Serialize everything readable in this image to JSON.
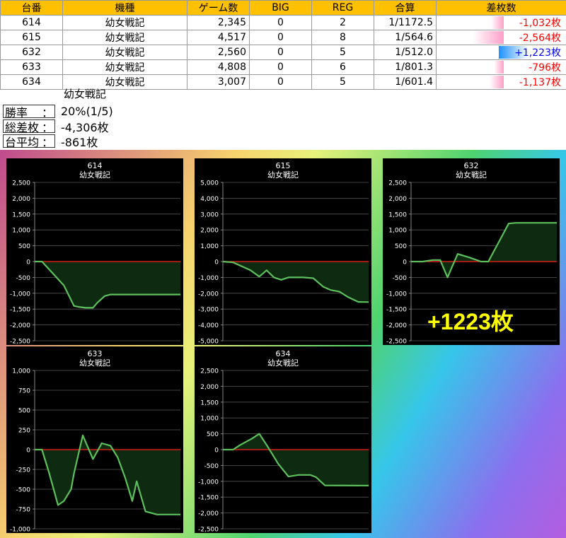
{
  "table": {
    "headers": [
      "台番",
      "機種",
      "ゲーム数",
      "BIG",
      "REG",
      "合算",
      "差枚数"
    ],
    "rows": [
      {
        "no": "614",
        "model": "幼女戦記",
        "games": "2,345",
        "big": "0",
        "reg": "2",
        "combined": "1/1172.5",
        "diff": "-1,032枚",
        "diff_value": -1032
      },
      {
        "no": "615",
        "model": "幼女戦記",
        "games": "4,517",
        "big": "0",
        "reg": "8",
        "combined": "1/564.6",
        "diff": "-2,564枚",
        "diff_value": -2564
      },
      {
        "no": "632",
        "model": "幼女戦記",
        "games": "2,560",
        "big": "0",
        "reg": "5",
        "combined": "1/512.0",
        "diff": "+1,223枚",
        "diff_value": 1223
      },
      {
        "no": "633",
        "model": "幼女戦記",
        "games": "4,808",
        "big": "0",
        "reg": "6",
        "combined": "1/801.3",
        "diff": "-796枚",
        "diff_value": -796
      },
      {
        "no": "634",
        "model": "幼女戦記",
        "games": "3,007",
        "big": "0",
        "reg": "5",
        "combined": "1/601.4",
        "diff": "-1,137枚",
        "diff_value": -1137
      }
    ],
    "colors": {
      "header_bg": "#ffc000",
      "negative": "#ff0000",
      "positive": "#0000ff",
      "neg_bar": "#ff9ec8",
      "pos_bar": "#1e90ff"
    }
  },
  "summary": {
    "title": "幼女戦記",
    "rows": [
      {
        "label": "勝率",
        "colon": "：",
        "value": "20%(1/5)"
      },
      {
        "label": "総差枚",
        "colon": "：",
        "value": "-4,306枚"
      },
      {
        "label": "台平均",
        "colon": "：",
        "value": "-861枚"
      }
    ]
  },
  "highlight_label": "+1223枚",
  "chart_data": [
    {
      "type": "line",
      "title": "614",
      "subtitle": "幼女戦記",
      "ylim": [
        -2500,
        2500
      ],
      "yticks": [
        -2500,
        -2000,
        -1500,
        -1000,
        -500,
        0,
        500,
        1000,
        1500,
        2000,
        2500
      ],
      "grid": true,
      "x": [
        0,
        0.05,
        0.1,
        0.2,
        0.27,
        0.3,
        0.35,
        0.4,
        0.43,
        0.48,
        0.52,
        0.6,
        0.7,
        1.0
      ],
      "y": [
        0,
        0,
        -250,
        -750,
        -1400,
        -1430,
        -1460,
        -1460,
        -1300,
        -1090,
        -1040,
        -1040,
        -1040,
        -1040
      ]
    },
    {
      "type": "line",
      "title": "615",
      "subtitle": "幼女戦記",
      "ylim": [
        -5000,
        5000
      ],
      "yticks": [
        -5000,
        -4000,
        -3000,
        -2000,
        -1000,
        0,
        1000,
        2000,
        3000,
        4000,
        5000
      ],
      "grid": true,
      "x": [
        0,
        0.07,
        0.13,
        0.19,
        0.25,
        0.3,
        0.35,
        0.4,
        0.45,
        0.5,
        0.55,
        0.62,
        0.69,
        0.74,
        0.8,
        0.86,
        0.93,
        1.0
      ],
      "y": [
        0,
        -50,
        -300,
        -550,
        -950,
        -550,
        -1000,
        -1150,
        -1000,
        -1000,
        -1000,
        -1050,
        -1600,
        -1800,
        -1900,
        -2250,
        -2550,
        -2560
      ]
    },
    {
      "type": "line",
      "title": "632",
      "subtitle": "幼女戦記",
      "ylim": [
        -2500,
        2500
      ],
      "yticks": [
        -2500,
        -2000,
        -1500,
        -1000,
        -500,
        0,
        500,
        1000,
        1500,
        2000,
        2500
      ],
      "grid": true,
      "x": [
        0,
        0.08,
        0.15,
        0.2,
        0.25,
        0.32,
        0.4,
        0.48,
        0.53,
        0.6,
        0.67,
        0.72,
        1.0
      ],
      "y": [
        0,
        0,
        50,
        50,
        -500,
        240,
        130,
        0,
        0,
        600,
        1200,
        1223,
        1223
      ]
    },
    {
      "type": "line",
      "title": "633",
      "subtitle": "幼女戦記",
      "ylim": [
        -1000,
        1000
      ],
      "yticks": [
        -1000,
        -750,
        -500,
        -250,
        0,
        250,
        500,
        750,
        1000
      ],
      "grid": true,
      "x": [
        0,
        0.05,
        0.1,
        0.16,
        0.2,
        0.25,
        0.27,
        0.33,
        0.4,
        0.46,
        0.52,
        0.57,
        0.62,
        0.67,
        0.7,
        0.76,
        0.84,
        1.0
      ],
      "y": [
        0,
        0,
        -300,
        -700,
        -650,
        -500,
        -300,
        180,
        -120,
        80,
        50,
        -100,
        -350,
        -650,
        -400,
        -780,
        -820,
        -820
      ]
    },
    {
      "type": "line",
      "title": "634",
      "subtitle": "幼女戦記",
      "ylim": [
        -2500,
        2500
      ],
      "yticks": [
        -2500,
        -2000,
        -1500,
        -1000,
        -500,
        0,
        500,
        1000,
        1500,
        2000,
        2500
      ],
      "grid": true,
      "x": [
        0,
        0.07,
        0.12,
        0.2,
        0.25,
        0.3,
        0.38,
        0.45,
        0.52,
        0.55,
        0.6,
        0.64,
        0.7,
        1.0
      ],
      "y": [
        0,
        0,
        150,
        350,
        500,
        150,
        -450,
        -850,
        -800,
        -800,
        -800,
        -870,
        -1130,
        -1137
      ]
    }
  ]
}
